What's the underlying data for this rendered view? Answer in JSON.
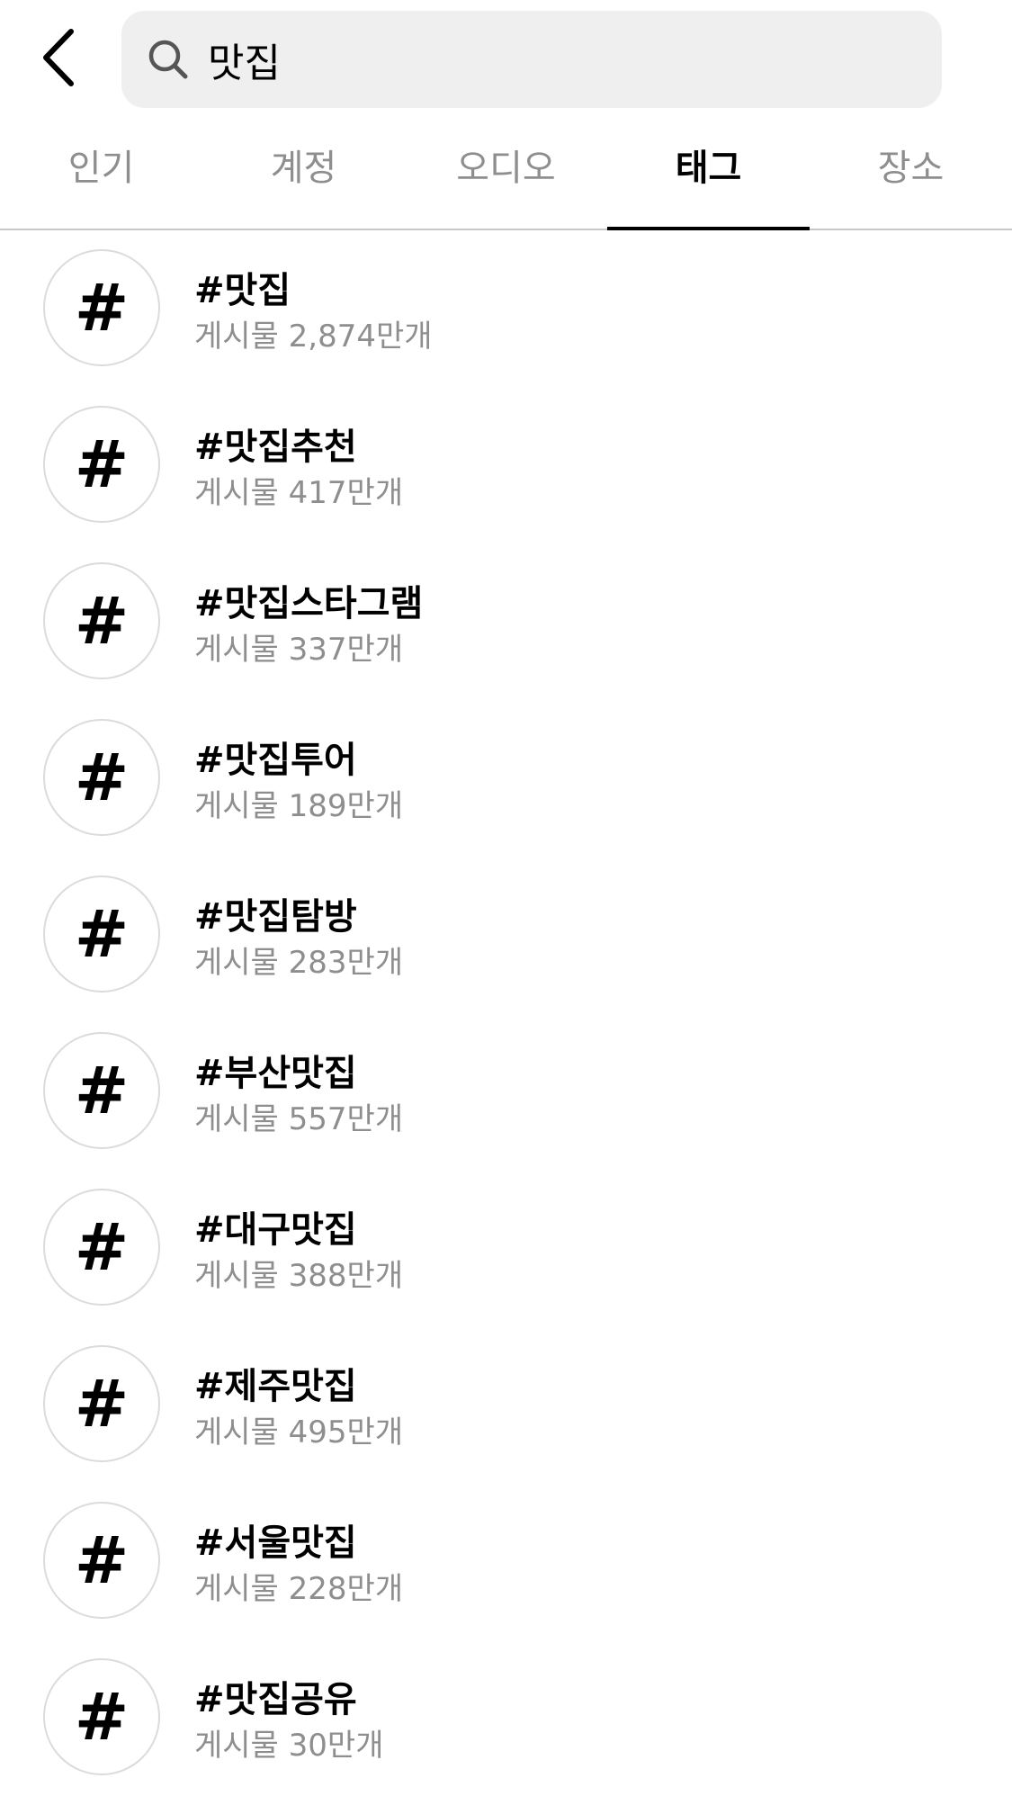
{
  "search": {
    "value": "맛집"
  },
  "icons": {
    "back": "chevron-left-icon",
    "search": "search-icon",
    "hashtag": "hashtag-icon"
  },
  "tabs": [
    {
      "label": "인기",
      "active": false
    },
    {
      "label": "계정",
      "active": false
    },
    {
      "label": "오디오",
      "active": false
    },
    {
      "label": "태그",
      "active": true
    },
    {
      "label": "장소",
      "active": false
    }
  ],
  "hashtag_symbol": "#",
  "results": [
    {
      "tag": "#맛집",
      "count": "게시물 2,874만개"
    },
    {
      "tag": "#맛집추천",
      "count": "게시물 417만개"
    },
    {
      "tag": "#맛집스타그램",
      "count": "게시물 337만개"
    },
    {
      "tag": "#맛집투어",
      "count": "게시물 189만개"
    },
    {
      "tag": "#맛집탐방",
      "count": "게시물 283만개"
    },
    {
      "tag": "#부산맛집",
      "count": "게시물 557만개"
    },
    {
      "tag": "#대구맛집",
      "count": "게시물 388만개"
    },
    {
      "tag": "#제주맛집",
      "count": "게시물 495만개"
    },
    {
      "tag": "#서울맛집",
      "count": "게시물 228만개"
    },
    {
      "tag": "#맛집공유",
      "count": "게시물 30만개"
    }
  ],
  "colors": {
    "text_primary": "#000000",
    "text_secondary": "#8e8e8e",
    "search_bg": "#efefef",
    "divider": "#c8c8c8",
    "circle_border": "#dbdbdb"
  }
}
